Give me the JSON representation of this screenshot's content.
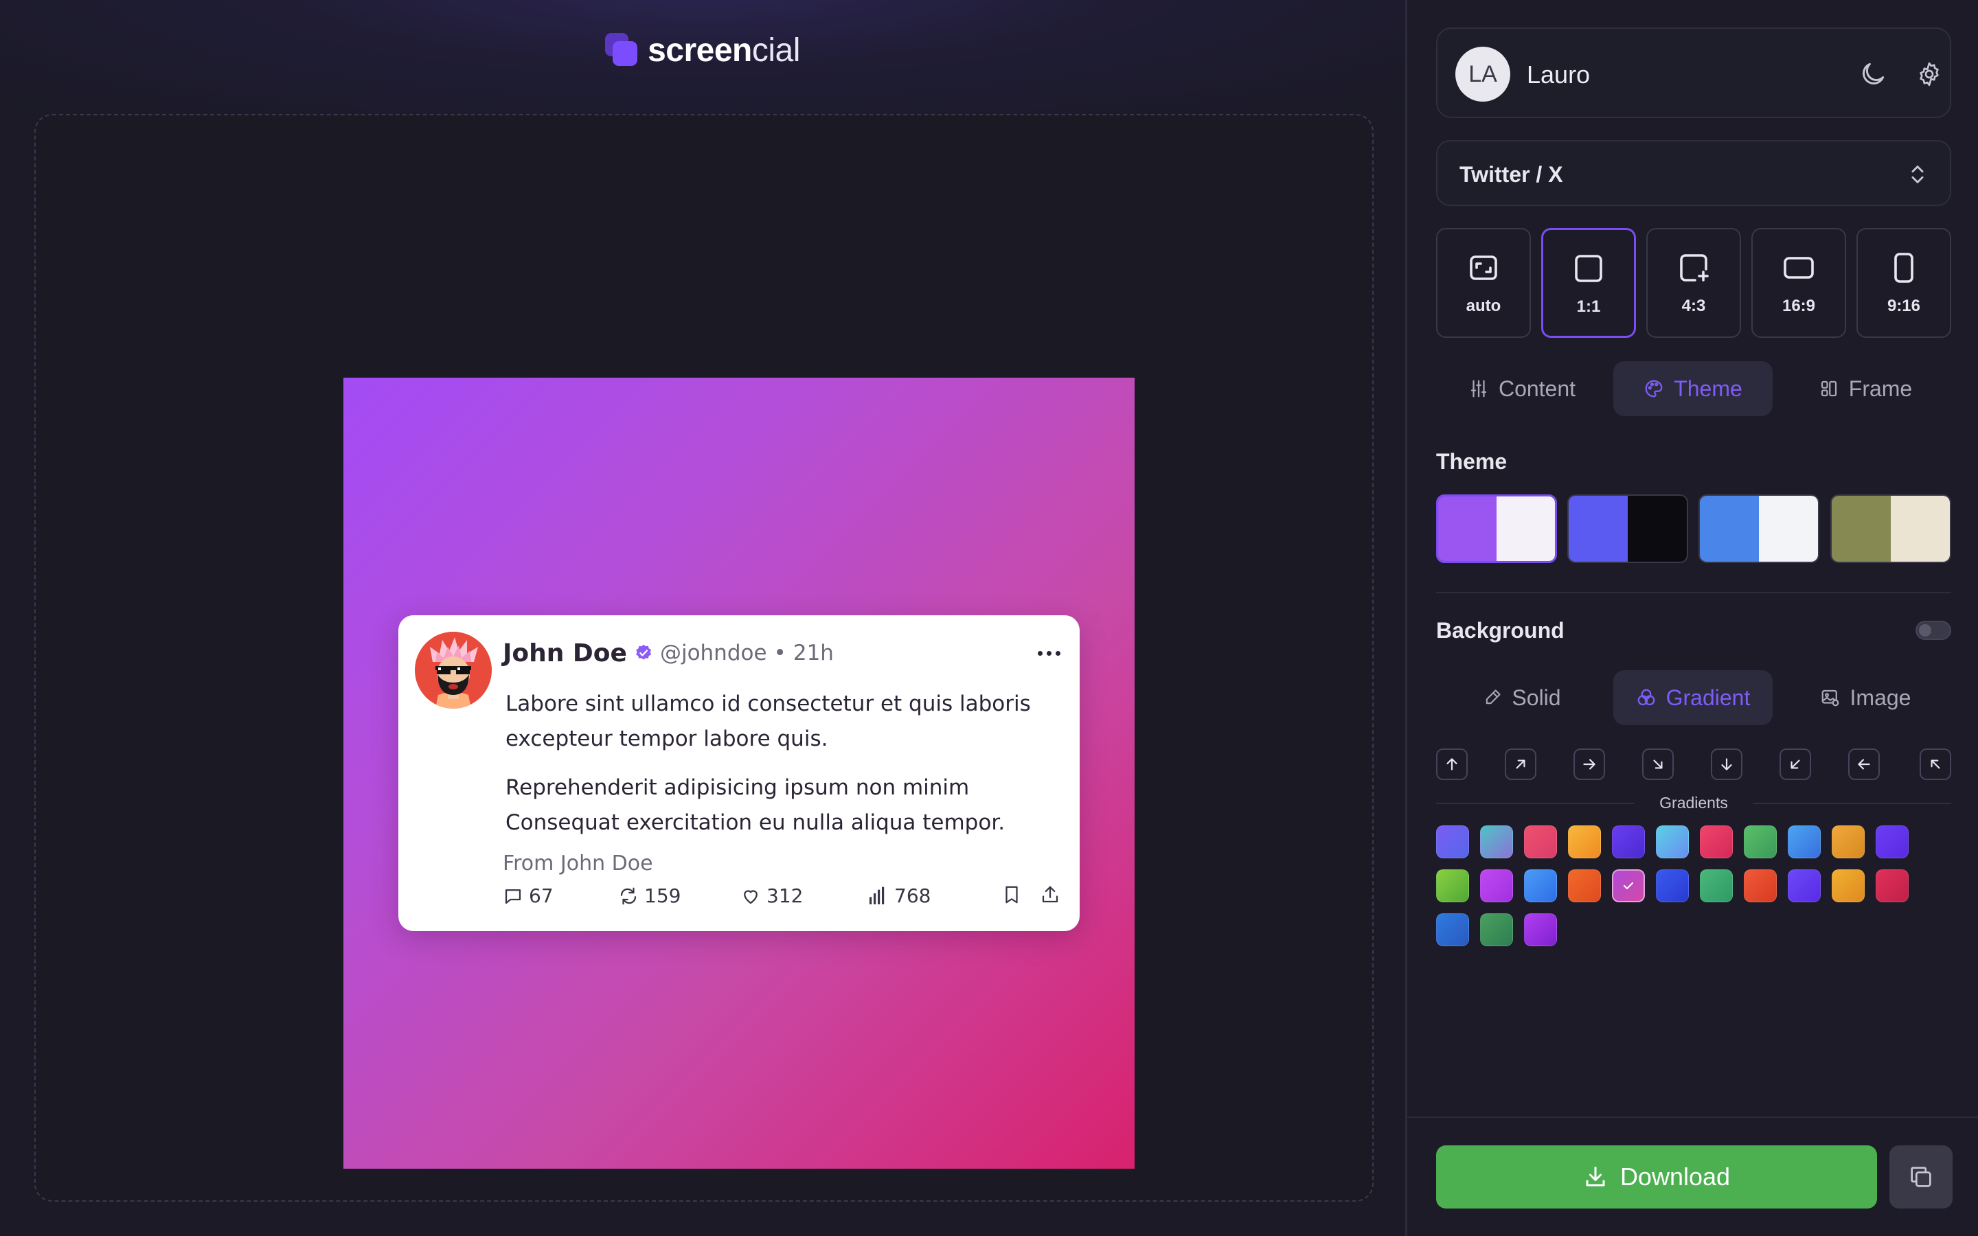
{
  "app": {
    "logo_bold": "screen",
    "logo_light": "cial"
  },
  "tweet": {
    "name": "John Doe",
    "handle": "@johndoe",
    "separator": "•",
    "time": "21h",
    "paragraphs": [
      "Labore sint ullamco id consectetur et quis laboris excepteur tempor labore quis.",
      "Reprehenderit adipisicing ipsum non minim Consequat exercitation eu nulla aliqua tempor."
    ],
    "from": "From John Doe",
    "replies": "67",
    "retweets": "159",
    "likes": "312",
    "views": "768"
  },
  "artboard": {
    "gradient_start": "#a34cf5",
    "gradient_end": "#d8226e"
  },
  "user": {
    "initials": "LA",
    "name": "Lauro"
  },
  "platform": {
    "selected": "Twitter / X"
  },
  "ratios": [
    {
      "label": "auto",
      "icon": "auto-ratio-icon"
    },
    {
      "label": "1:1",
      "icon": "square-icon",
      "active": true
    },
    {
      "label": "4:3",
      "icon": "square-plus-icon"
    },
    {
      "label": "16:9",
      "icon": "landscape-icon"
    },
    {
      "label": "9:16",
      "icon": "portrait-icon"
    }
  ],
  "tabs": {
    "content": "Content",
    "theme": "Theme",
    "frame": "Frame",
    "active": "Theme"
  },
  "theme_section": {
    "title": "Theme",
    "swatches": [
      {
        "a": "#9b55f0",
        "b": "#f4f2f8",
        "active": true
      },
      {
        "a": "#5b5bf2",
        "b": "#0c0c10"
      },
      {
        "a": "#4a86ea",
        "b": "#f2f4f8"
      },
      {
        "a": "#868a52",
        "b": "#ece4d2"
      }
    ]
  },
  "background_section": {
    "title": "Background",
    "toggle_on": false,
    "tabs": {
      "solid": "Solid",
      "gradient": "Gradient",
      "image": "Image",
      "active": "Gradient"
    },
    "directions": [
      "arrow-up-icon",
      "arrow-up-right-icon",
      "arrow-right-icon",
      "arrow-down-right-icon",
      "arrow-down-icon",
      "arrow-down-left-icon",
      "arrow-left-icon",
      "arrow-up-left-icon"
    ],
    "gradients_label": "Gradients",
    "gradients": [
      [
        "#7b5cf5",
        "#5468e8"
      ],
      [
        "#4fc3c7",
        "#8b72d8"
      ],
      [
        "#f0506e",
        "#d93d6a"
      ],
      [
        "#f6b93b",
        "#f08a24"
      ],
      [
        "#6a3df0",
        "#4a2bd0"
      ],
      [
        "#5ad0e6",
        "#6a8ef0"
      ],
      [
        "#f0456a",
        "#d4285a"
      ],
      [
        "#5ac06a",
        "#3a9a58"
      ],
      [
        "#4aa6f0",
        "#3a6ee0"
      ],
      [
        "#f0a83a",
        "#d88a20"
      ],
      [
        "#6a3df5",
        "#5a2ae0"
      ],
      [
        "#8ad040",
        "#50a838"
      ],
      [
        "#c04af0",
        "#a030e0"
      ],
      [
        "#4a9cf5",
        "#2e6ee8"
      ],
      [
        "#f06a2a",
        "#e04a20"
      ],
      [
        "#b04ad8",
        "#d24aa8"
      ],
      [
        "#3a5af0",
        "#2a3ad0"
      ],
      [
        "#4ab878",
        "#2e9a68"
      ],
      [
        "#f05a3a",
        "#d83a20"
      ],
      [
        "#6a4af5",
        "#5a2ae8"
      ],
      [
        "#f0b030",
        "#e08a20"
      ],
      [
        "#e0305a",
        "#c02048"
      ],
      [
        "#2e7ae0",
        "#2a5ac0"
      ],
      [
        "#4aa060",
        "#2e7e50"
      ],
      [
        "#b040f0",
        "#8020d0"
      ]
    ],
    "selected_gradient_index": 15
  },
  "actions": {
    "download": "Download"
  },
  "colors": {
    "accent": "#7a4df0",
    "download_bg": "#4caf50",
    "verified": "#8b5cf6"
  }
}
